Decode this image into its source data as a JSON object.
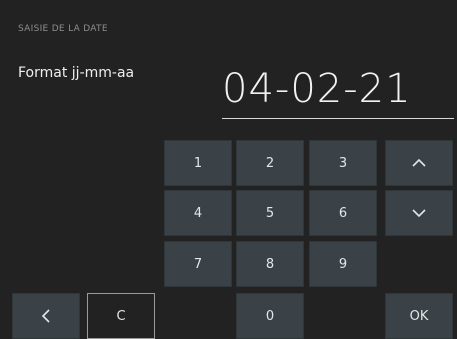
{
  "screen": {
    "title": "SAISIE DE LA DATE",
    "format_label": "Format jj-mm-aa",
    "date_value": "04-02-21"
  },
  "keypad": {
    "k1": "1",
    "k2": "2",
    "k3": "3",
    "k4": "4",
    "k5": "5",
    "k6": "6",
    "k7": "7",
    "k8": "8",
    "k9": "9",
    "k0": "0",
    "clear": "C",
    "ok": "OK"
  },
  "icons": {
    "up": "chevron-up-icon",
    "down": "chevron-down-icon",
    "back": "chevron-left-icon"
  },
  "colors": {
    "background": "#222222",
    "key": "#3a4247",
    "text": "#e6e6e6"
  }
}
